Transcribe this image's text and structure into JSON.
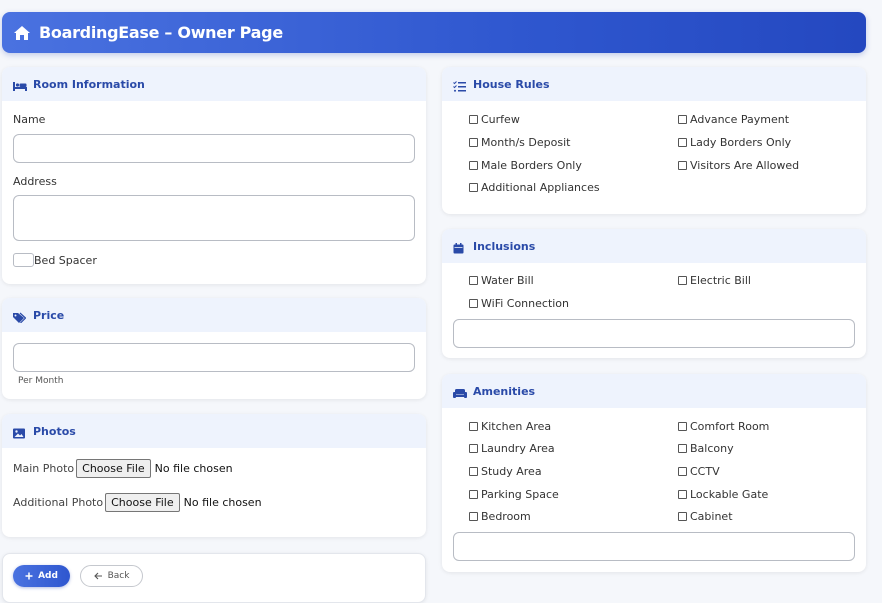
{
  "header": {
    "title": "BoardingEase – Owner Page",
    "icon": "home-icon"
  },
  "room_info": {
    "title": "Room Information",
    "name_label": "Name",
    "name_value": "",
    "address_label": "Address",
    "address_value": "",
    "bed_spacer_label": "Bed Spacer"
  },
  "price": {
    "title": "Price",
    "value": "",
    "hint": "Per Month"
  },
  "photos": {
    "title": "Photos",
    "main_label": "Main Photo",
    "additional_label": "Additional Photo",
    "choose_label": "Choose File",
    "no_file": "No file chosen"
  },
  "actions": {
    "add_label": "Add",
    "back_label": "Back"
  },
  "house_rules": {
    "title": "House Rules",
    "items": [
      "Curfew",
      "Advance Payment",
      "Month/s Deposit",
      "Lady Borders Only",
      "Male Borders Only",
      "Visitors Are Allowed",
      "Additional Appliances"
    ]
  },
  "inclusions": {
    "title": "Inclusions",
    "items": [
      "Water Bill",
      "Electric Bill",
      "WiFi Connection"
    ],
    "other_value": ""
  },
  "amenities": {
    "title": "Amenities",
    "items": [
      "Kitchen Area",
      "Comfort Room",
      "Laundry Area",
      "Balcony",
      "Study Area",
      "CCTV",
      "Parking Space",
      "Lockable Gate",
      "Bedroom",
      "Cabinet"
    ],
    "other_value": ""
  },
  "colors": {
    "accent": "#2f57cf",
    "header_bg": "#eef3fd",
    "section_title": "#2a4aa8"
  }
}
